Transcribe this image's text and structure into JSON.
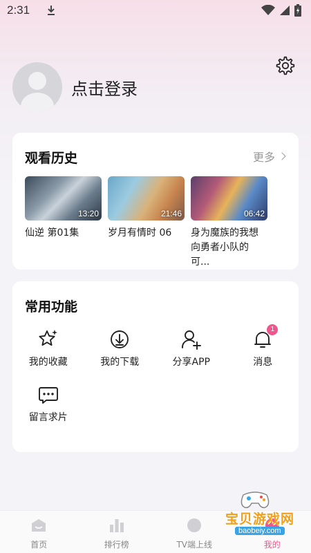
{
  "status_bar": {
    "time": "2:31"
  },
  "profile": {
    "login_label": "点击登录"
  },
  "history": {
    "title": "观看历史",
    "more_label": "更多",
    "items": [
      {
        "title": "仙逆 第01集",
        "duration": "13:20"
      },
      {
        "title": "岁月有情时 06",
        "duration": "21:46"
      },
      {
        "title": "身为魔族的我想\n向勇者小队的可...",
        "duration": "06:42"
      }
    ]
  },
  "common": {
    "title": "常用功能",
    "items": [
      {
        "label": "我的收藏",
        "icon": "star-icon"
      },
      {
        "label": "我的下载",
        "icon": "download-icon"
      },
      {
        "label": "分享APP",
        "icon": "share-user-icon"
      },
      {
        "label": "消息",
        "icon": "bell-icon",
        "badge": "1"
      },
      {
        "label": "留言求片",
        "icon": "message-icon"
      }
    ]
  },
  "tabbar": {
    "items": [
      {
        "label": "首页",
        "icon": "home-icon"
      },
      {
        "label": "排行榜",
        "icon": "ranking-icon"
      },
      {
        "label": "TV端上线",
        "icon": "tv-icon"
      },
      {
        "label": "我的",
        "icon": "profile-icon",
        "active": true
      }
    ]
  },
  "watermark": {
    "text": "宝贝游戏网",
    "url": "baobeiy.com"
  },
  "colors": {
    "accent": "#f0568c",
    "background": "#f4f4f8"
  }
}
